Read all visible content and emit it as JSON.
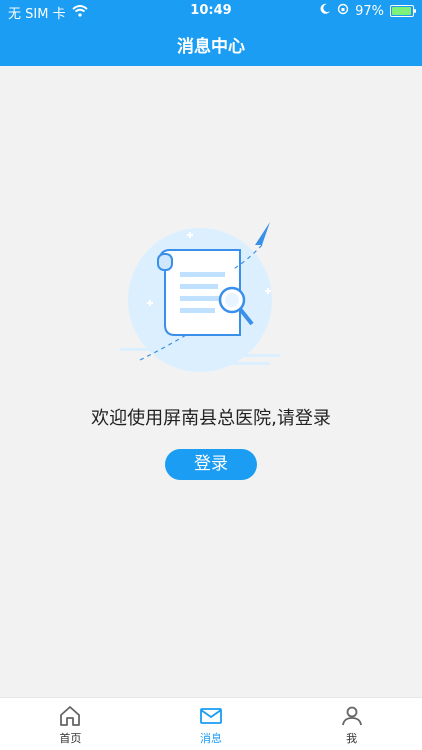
{
  "status_bar": {
    "carrier": "无 SIM 卡",
    "time": "10:49",
    "battery_percent": "97%",
    "battery_level": 0.97
  },
  "header": {
    "title": "消息中心"
  },
  "empty_state": {
    "message": "欢迎使用屏南县总医院,请登录",
    "login_label": "登录"
  },
  "tabbar": {
    "items": [
      {
        "label": "首页",
        "icon": "home-icon",
        "active": false
      },
      {
        "label": "消息",
        "icon": "mail-icon",
        "active": true
      },
      {
        "label": "我",
        "icon": "user-icon",
        "active": false
      }
    ]
  },
  "colors": {
    "primary": "#1a9df3",
    "background": "#f2f2f2"
  }
}
